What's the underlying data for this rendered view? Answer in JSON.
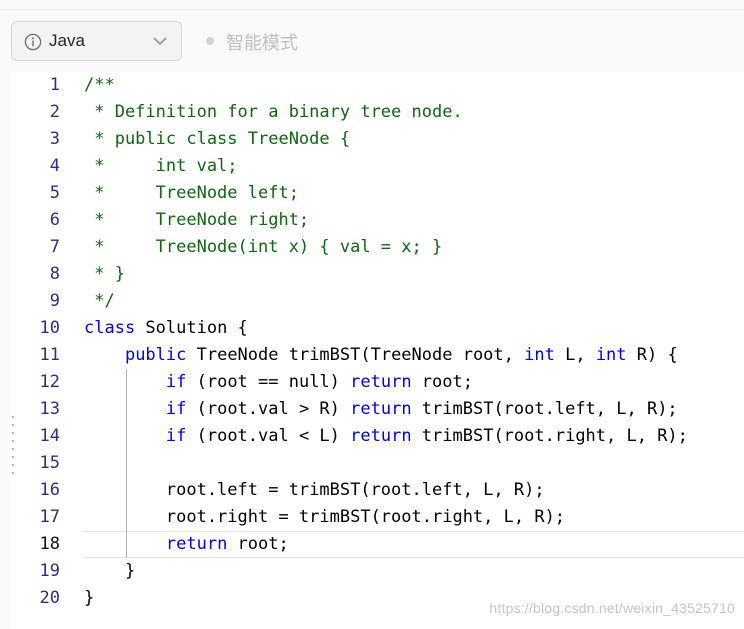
{
  "toolbar": {
    "language": "Java",
    "mode_label": "智能模式"
  },
  "editor": {
    "active_line": 18,
    "lines": [
      {
        "n": "1",
        "segments": [
          {
            "t": "/**",
            "c": "comment"
          }
        ]
      },
      {
        "n": "2",
        "segments": [
          {
            "t": " * Definition for a binary tree node.",
            "c": "comment"
          }
        ]
      },
      {
        "n": "3",
        "segments": [
          {
            "t": " * public class TreeNode {",
            "c": "comment"
          }
        ]
      },
      {
        "n": "4",
        "segments": [
          {
            "t": " *     int val;",
            "c": "comment"
          }
        ]
      },
      {
        "n": "5",
        "segments": [
          {
            "t": " *     TreeNode left;",
            "c": "comment"
          }
        ]
      },
      {
        "n": "6",
        "segments": [
          {
            "t": " *     TreeNode right;",
            "c": "comment"
          }
        ]
      },
      {
        "n": "7",
        "segments": [
          {
            "t": " *     TreeNode(int x) { val = x; }",
            "c": "comment"
          }
        ]
      },
      {
        "n": "8",
        "segments": [
          {
            "t": " * }",
            "c": "comment"
          }
        ]
      },
      {
        "n": "9",
        "segments": [
          {
            "t": " */",
            "c": "comment"
          }
        ]
      },
      {
        "n": "10",
        "segments": [
          {
            "t": "class",
            "c": "keyword"
          },
          {
            "t": " Solution {",
            "c": "plain"
          }
        ]
      },
      {
        "n": "11",
        "segments": [
          {
            "t": "    ",
            "c": "plain"
          },
          {
            "t": "public",
            "c": "keyword"
          },
          {
            "t": " TreeNode trimBST(TreeNode root, ",
            "c": "plain"
          },
          {
            "t": "int",
            "c": "keyword"
          },
          {
            "t": " L, ",
            "c": "plain"
          },
          {
            "t": "int",
            "c": "keyword"
          },
          {
            "t": " R) {",
            "c": "plain"
          }
        ]
      },
      {
        "n": "12",
        "segments": [
          {
            "t": "        ",
            "c": "plain"
          },
          {
            "t": "if",
            "c": "keyword"
          },
          {
            "t": " (root == null) ",
            "c": "plain"
          },
          {
            "t": "return",
            "c": "keyword"
          },
          {
            "t": " root;",
            "c": "plain"
          }
        ]
      },
      {
        "n": "13",
        "segments": [
          {
            "t": "        ",
            "c": "plain"
          },
          {
            "t": "if",
            "c": "keyword"
          },
          {
            "t": " (root.val > R) ",
            "c": "plain"
          },
          {
            "t": "return",
            "c": "keyword"
          },
          {
            "t": " trimBST(root.left, L, R);",
            "c": "plain"
          }
        ]
      },
      {
        "n": "14",
        "segments": [
          {
            "t": "        ",
            "c": "plain"
          },
          {
            "t": "if",
            "c": "keyword"
          },
          {
            "t": " (root.val < L) ",
            "c": "plain"
          },
          {
            "t": "return",
            "c": "keyword"
          },
          {
            "t": " trimBST(root.right, L, R);",
            "c": "plain"
          }
        ]
      },
      {
        "n": "15",
        "segments": [
          {
            "t": "",
            "c": "plain"
          }
        ]
      },
      {
        "n": "16",
        "segments": [
          {
            "t": "        root.left = trimBST(root.left, L, R);",
            "c": "plain"
          }
        ]
      },
      {
        "n": "17",
        "segments": [
          {
            "t": "        root.right = trimBST(root.right, L, R);",
            "c": "plain"
          }
        ]
      },
      {
        "n": "18",
        "segments": [
          {
            "t": "        ",
            "c": "plain"
          },
          {
            "t": "return",
            "c": "keyword"
          },
          {
            "t": " root;",
            "c": "plain"
          }
        ]
      },
      {
        "n": "19",
        "segments": [
          {
            "t": "    }",
            "c": "plain"
          }
        ]
      },
      {
        "n": "20",
        "segments": [
          {
            "t": "}",
            "c": "plain"
          }
        ]
      }
    ]
  },
  "watermark": "https://blog.csdn.net/weixin_43525710"
}
